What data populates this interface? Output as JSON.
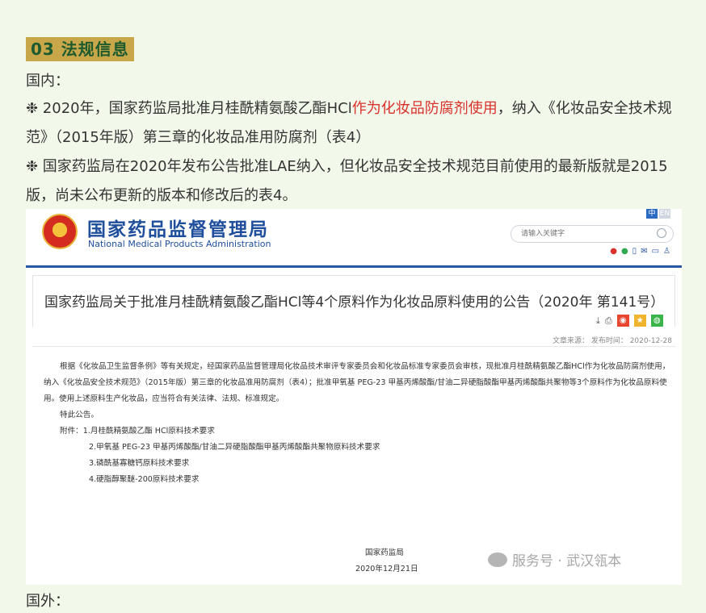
{
  "section": {
    "title": "03  法规信息"
  },
  "domestic_label": "国内：",
  "bullet1": {
    "prefix": "❉ 2020年，国家药监局批准月桂酰精氨酸乙酯HCl",
    "highlight": "作为化妆品防腐剂使用",
    "suffix": "，纳入《化妆品安全技术规范》（2015年版）第三章的化妆品准用防腐剂（表4）"
  },
  "bullet2": "❉ 国家药监局在2020年发布公告批准LAE纳入，但化妆品安全技术规范目前使用的最新版就是2015版，尚未公布更新的版本和修改后的表4。",
  "foreign_label": "国外：",
  "colors": {
    "highlight": "#d9312c",
    "title_bg": "#c8a74a",
    "title_fg": "#1d5a2e",
    "page_bg": "#f2f8ea",
    "site_blue": "#1f4f9c"
  },
  "screenshot": {
    "site_name_cn": "国家药品监督管理局",
    "site_name_en": "National Medical Products Administration",
    "lang_cn": "中",
    "lang_en": "EN",
    "search_placeholder": "请输入关键字",
    "social_icons": [
      "weibo-icon",
      "wechat-icon",
      "mobile-icon",
      "mail-icon",
      "message-icon",
      "user-icon"
    ],
    "article_title": "国家药监局关于批准月桂酰精氨酸乙酯HCl等4个原料作为化妆品原料使用的公告（2020年 第141号）",
    "tool_download": "⤓",
    "tool_print": "⎙",
    "meta": "文章来源：   发布时间：  2020-12-28",
    "paragraph": "根据《化妆品卫生监督条例》等有关规定，经国家药品监督管理局化妆品技术审评专家委员会和化妆品标准专家委员会审核，现批准月桂酰精氨酸乙酯HCl作为化妆品防腐剂使用，纳入《化妆品安全技术规范》（2015年版）第三章的化妆品准用防腐剂（表4）；批准甲氧基 PEG-23 甲基丙烯酸酯/甘油二异硬脂酸酯甲基丙烯酸酯共聚物等3个原料作为化妆品原料使用。使用上述原料生产化妆品，应当符合有关法律、法规、标准规定。",
    "notice": "特此公告。",
    "attachments": [
      "附件：1.月桂酰精氨酸乙酯 HCl原料技术要求",
      "2.甲氧基 PEG-23 甲基丙烯酸酯/甘油二异硬脂酸酯甲基丙烯酸酯共聚物原料技术要求",
      "3.磷酰基寡糖钙原料技术要求",
      "4.硬脂醇聚醚-200原料技术要求"
    ],
    "signer": "国家药监局",
    "date": "2020年12月21日",
    "watermark": "服务号 · 武汉瓴本"
  }
}
